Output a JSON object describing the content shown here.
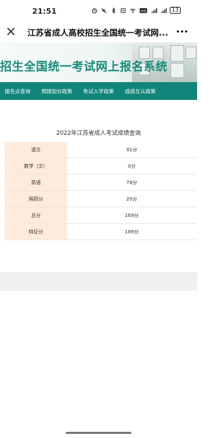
{
  "status_bar": {
    "time": "21:51",
    "battery": "13",
    "icons": [
      "alarm-icon",
      "mute-icon",
      "bluetooth-icon",
      "nfc-icon",
      "wifi-icon",
      "hd-icon",
      "signal-icon",
      "signal-icon",
      "battery-icon"
    ]
  },
  "title_bar": {
    "title": "江苏省成人高校招生全国统一考试网...",
    "close_icon": "close-icon",
    "more_icon": "more-icon"
  },
  "banner": {
    "text": "招生全国统一考试网上报名系统"
  },
  "nav": {
    "items": [
      {
        "label": "报名点查询"
      },
      {
        "label": "照顾加分政策"
      },
      {
        "label": "免试入学政策"
      },
      {
        "label": "成绩互认政策"
      }
    ]
  },
  "score": {
    "title": "2022年江苏省成人考试成绩查询",
    "rows": [
      {
        "subject": "语文",
        "score": "91分"
      },
      {
        "subject": "数学（文）",
        "score": "0分"
      },
      {
        "subject": "英语",
        "score": "78分"
      },
      {
        "subject": "照顾分",
        "score": "20分"
      },
      {
        "subject": "总分",
        "score": "169分"
      },
      {
        "subject": "特征分",
        "score": "189分"
      }
    ]
  },
  "colors": {
    "accent": "#11857a",
    "banner_text": "#1c8a7e",
    "label_cell": "#fdebdd"
  }
}
